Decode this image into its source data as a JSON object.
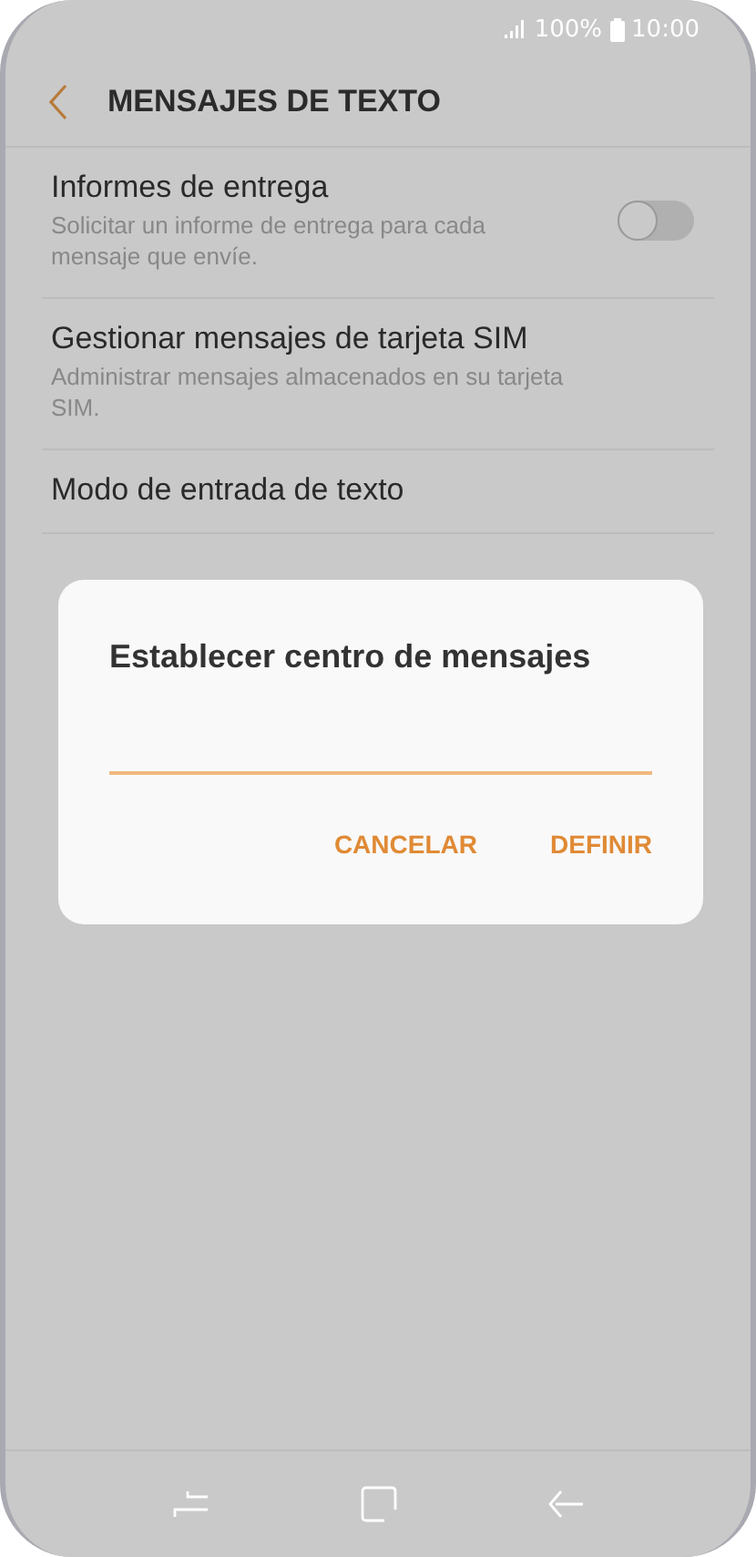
{
  "status_bar": {
    "battery_text": "100%",
    "time": "10:00"
  },
  "header": {
    "title": "MENSAJES DE TEXTO"
  },
  "settings": [
    {
      "kind": "toggle",
      "title": "Informes de entrega",
      "subtitle": "Solicitar un informe de entrega para cada mensaje que envíe.",
      "on": false
    },
    {
      "kind": "plain",
      "title": "Gestionar mensajes de tarjeta SIM",
      "subtitle": "Administrar mensajes almacenados en su tarjeta SIM."
    },
    {
      "kind": "plain",
      "title": "Modo de entrada de texto"
    }
  ],
  "dialog": {
    "title": "Establecer centro de mensajes",
    "buttons": [
      "CANCELAR",
      "DEFINIR"
    ]
  }
}
